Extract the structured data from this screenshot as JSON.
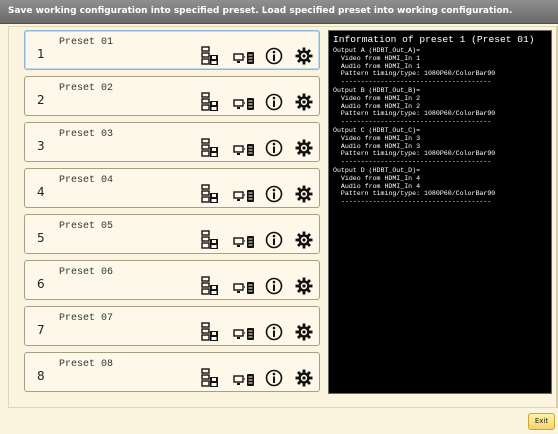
{
  "title_bar": {
    "text": "Save working configuration into specified preset. Load specified preset into working configuration."
  },
  "presets": [
    {
      "number": "1",
      "name": "Preset 01",
      "selected": true
    },
    {
      "number": "2",
      "name": "Preset 02",
      "selected": false
    },
    {
      "number": "3",
      "name": "Preset 03",
      "selected": false
    },
    {
      "number": "4",
      "name": "Preset 04",
      "selected": false
    },
    {
      "number": "5",
      "name": "Preset 05",
      "selected": false
    },
    {
      "number": "6",
      "name": "Preset 06",
      "selected": false
    },
    {
      "number": "7",
      "name": "Preset 07",
      "selected": false
    },
    {
      "number": "8",
      "name": "Preset 08",
      "selected": false
    }
  ],
  "preset_actions": [
    {
      "icon": "save-preset-icon"
    },
    {
      "icon": "load-preset-icon"
    },
    {
      "icon": "info-icon"
    },
    {
      "icon": "settings-gear-icon"
    }
  ],
  "info_panel": {
    "title": "Information of preset 1 (Preset 01)",
    "outputs": [
      {
        "header": "Output A (HDBT_Out_A)=",
        "video": "  Video from HDMI_In 1",
        "audio": "  Audio from HDMI_In 1",
        "pattern": "  Pattern timing/type: 1080P60/ColorBar90",
        "divider": "  --------------------------------------"
      },
      {
        "header": "Output B (HDBT_Out_B)=",
        "video": "  Video from HDMI_In 2",
        "audio": "  Audio from HDMI_In 2",
        "pattern": "  Pattern timing/type: 1080P60/ColorBar90",
        "divider": "  --------------------------------------"
      },
      {
        "header": "Output C (HDBT_Out_C)=",
        "video": "  Video from HDMI_In 3",
        "audio": "  Audio from HDMI_In 3",
        "pattern": "  Pattern timing/type: 1080P60/ColorBar90",
        "divider": "  --------------------------------------"
      },
      {
        "header": "Output D (HDBT_Out_D)=",
        "video": "  Video from HDMI_In 4",
        "audio": "  Audio from HDMI_In 4",
        "pattern": "  Pattern timing/type: 1080P60/ColorBar90",
        "divider": "  --------------------------------------"
      }
    ]
  },
  "footer": {
    "exit_label": "Exit"
  },
  "colors": {
    "background": "#fbf4df",
    "titlebar": "#7a7a7a",
    "info_background": "#000000",
    "selected_border": "#8fb5d8",
    "exit_button": "#f4d36a"
  }
}
